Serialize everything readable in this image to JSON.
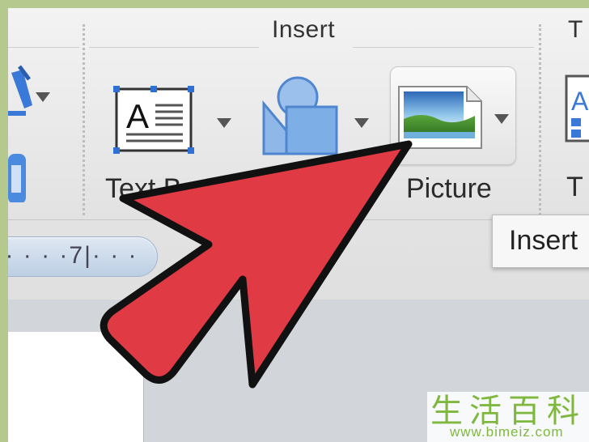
{
  "ribbon": {
    "group_insert_label": "Insert",
    "group_next_label": "T",
    "buttons": {
      "text_box_label": "Text Box",
      "picture_label": "Picture",
      "right_partial_label": "T"
    }
  },
  "tooltip": {
    "text": "Insert"
  },
  "ruler": {
    "text": "· · · ·7|· · ·"
  },
  "watermark": {
    "cn": "生活百科",
    "url": "www.bimeiz.com"
  },
  "colors": {
    "arrow_fill": "#e03a45",
    "arrow_stroke": "#111111",
    "accent_blue": "#2f6fd6",
    "watermark_green": "#7fb83e"
  },
  "icons": [
    "wordart-icon",
    "text-box-icon",
    "shapes-icon",
    "picture-icon",
    "dropdown-chevron-icon"
  ]
}
